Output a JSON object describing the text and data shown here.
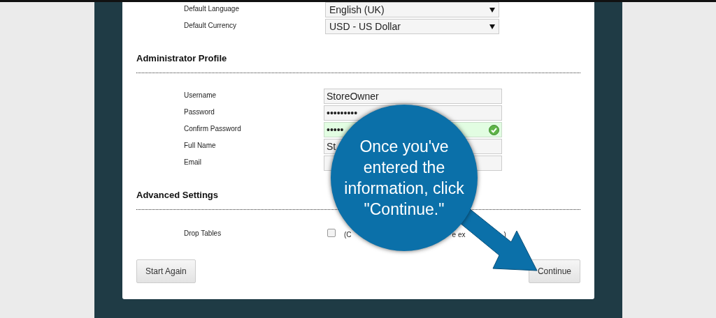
{
  "sections": [
    {
      "rows": [
        {
          "label": "Default Language",
          "kind": "select",
          "value": "English (UK)"
        },
        {
          "label": "Default Currency",
          "kind": "select",
          "value": "USD - US Dollar"
        }
      ]
    },
    {
      "title": "Administrator Profile",
      "rows": [
        {
          "label": "Username",
          "kind": "text",
          "value": "StoreOwner",
          "valid": false
        },
        {
          "label": "Password",
          "kind": "text",
          "value": "•••••••••",
          "valid": false
        },
        {
          "label": "Confirm Password",
          "kind": "text",
          "value": "•••••",
          "valid": true
        },
        {
          "label": "Full Name",
          "kind": "text",
          "value": "St",
          "valid": false
        },
        {
          "label": "Email",
          "kind": "text",
          "valid": false
        }
      ]
    },
    {
      "title": "Advanced Settings",
      "rows": [
        {
          "label": "Drop Tables",
          "kind": "checkbox",
          "checked": false,
          "hint_fragments": [
            "(C",
            "e ex",
            ")"
          ]
        }
      ]
    }
  ],
  "buttons": [
    {
      "label": "Start Again"
    },
    {
      "label": "Continue"
    }
  ],
  "callout": {
    "lines": [
      "Once you've",
      "entered the",
      "information, click",
      "\"Continue.\""
    ]
  }
}
